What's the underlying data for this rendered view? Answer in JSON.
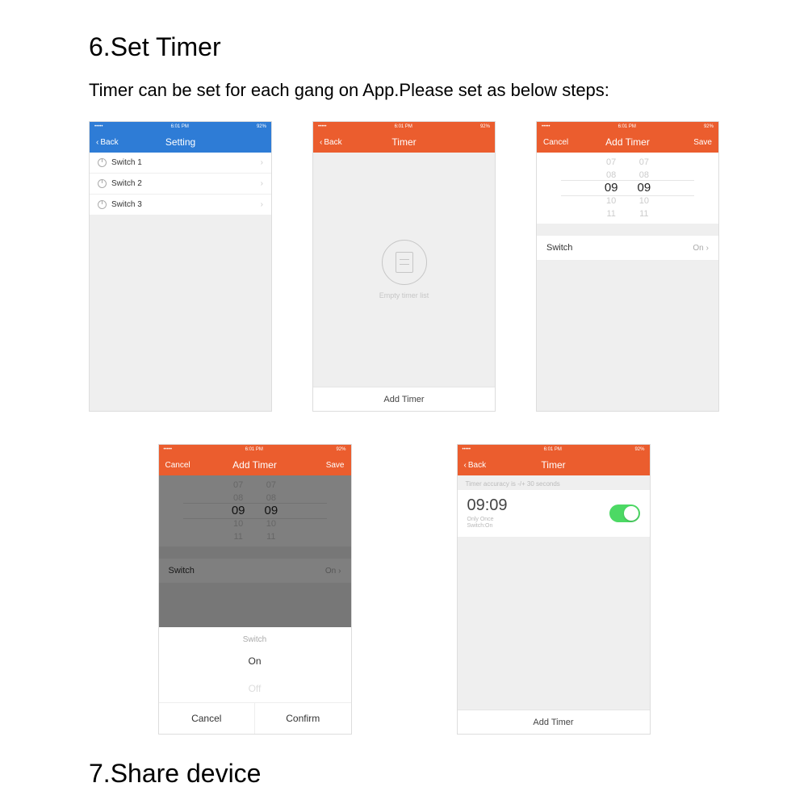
{
  "section_heading": "6.Set Timer",
  "subtext": "Timer can be set for each gang on App.Please set as below steps:",
  "section_heading2": "7.Share device",
  "status": {
    "carrier": "•••••",
    "wifi": "ᯤ",
    "time": "6:01 PM",
    "battery": "92%"
  },
  "screen1": {
    "back": "Back",
    "title": "Setting",
    "items": [
      "Switch 1",
      "Switch 2",
      "Switch 3"
    ]
  },
  "screen2": {
    "back": "Back",
    "title": "Timer",
    "empty_label": "Empty timer list",
    "add_btn": "Add Timer"
  },
  "screen3": {
    "cancel": "Cancel",
    "title": "Add Timer",
    "save": "Save",
    "picker_rows": [
      "07",
      "08",
      "09",
      "10",
      "11"
    ],
    "switch_label": "Switch",
    "switch_value": "On"
  },
  "screen4": {
    "cancel_hdr": "Cancel",
    "title": "Add Timer",
    "save": "Save",
    "sheet_title": "Switch",
    "opt_on": "On",
    "opt_off": "Off",
    "cancel": "Cancel",
    "confirm": "Confirm"
  },
  "screen5": {
    "back": "Back",
    "title": "Timer",
    "accuracy": "Timer accuracy is -/+ 30 seconds",
    "time": "09:09",
    "meta1": "Only Once",
    "meta2": "Switch:On",
    "add_btn": "Add Timer"
  }
}
